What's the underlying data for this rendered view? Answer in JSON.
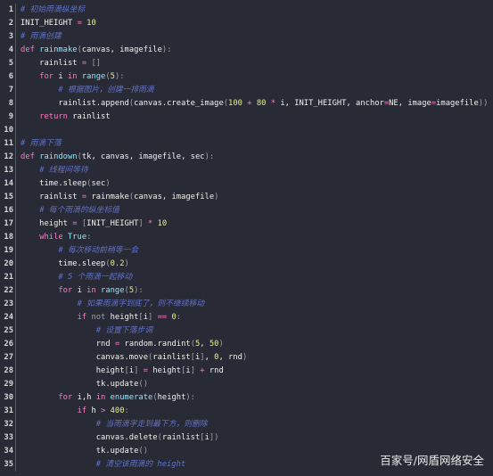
{
  "editor": {
    "lines": [
      {
        "n": "1",
        "tokens": [
          [
            "c",
            "# 初始雨滴纵坐标"
          ]
        ]
      },
      {
        "n": "2",
        "tokens": [
          [
            "t",
            "INIT_HEIGHT "
          ],
          [
            "o",
            "="
          ],
          [
            "t",
            " "
          ],
          [
            "n",
            "10"
          ]
        ]
      },
      {
        "n": "3",
        "tokens": [
          [
            "c",
            "# 雨滴创建"
          ]
        ]
      },
      {
        "n": "4",
        "tokens": [
          [
            "k",
            "def "
          ],
          [
            "f",
            "rainmake"
          ],
          [
            "p",
            "("
          ],
          [
            "t",
            "canvas, imagefile"
          ],
          [
            "p",
            "):"
          ]
        ]
      },
      {
        "n": "5",
        "tokens": [
          [
            "t",
            "    rainlist "
          ],
          [
            "o",
            "="
          ],
          [
            "p",
            " []"
          ]
        ]
      },
      {
        "n": "6",
        "tokens": [
          [
            "t",
            "    "
          ],
          [
            "k",
            "for "
          ],
          [
            "t",
            "i "
          ],
          [
            "k",
            "in "
          ],
          [
            "f",
            "range"
          ],
          [
            "p",
            "("
          ],
          [
            "n",
            "5"
          ],
          [
            "p",
            "):"
          ]
        ]
      },
      {
        "n": "7",
        "tokens": [
          [
            "t",
            "        "
          ],
          [
            "c",
            "# 根据图片，创建一排雨滴"
          ]
        ]
      },
      {
        "n": "8",
        "tokens": [
          [
            "t",
            "        rainlist.append"
          ],
          [
            "p",
            "("
          ],
          [
            "t",
            "canvas.create_image"
          ],
          [
            "p",
            "("
          ],
          [
            "n",
            "100"
          ],
          [
            "o",
            " + "
          ],
          [
            "n",
            "80"
          ],
          [
            "o",
            " * "
          ],
          [
            "t",
            "i, INIT_HEIGHT, anchor"
          ],
          [
            "o",
            "="
          ],
          [
            "t",
            "NE, image"
          ],
          [
            "o",
            "="
          ],
          [
            "t",
            "imagefile"
          ],
          [
            "p",
            "))"
          ]
        ]
      },
      {
        "n": "9",
        "tokens": [
          [
            "t",
            "    "
          ],
          [
            "k",
            "return "
          ],
          [
            "t",
            "rainlist"
          ]
        ]
      },
      {
        "n": "10",
        "tokens": []
      },
      {
        "n": "11",
        "tokens": [
          [
            "c",
            "# 雨滴下落"
          ]
        ]
      },
      {
        "n": "12",
        "tokens": [
          [
            "k",
            "def "
          ],
          [
            "f",
            "raindown"
          ],
          [
            "p",
            "("
          ],
          [
            "t",
            "tk, canvas, imagefile, sec"
          ],
          [
            "p",
            "):"
          ]
        ]
      },
      {
        "n": "13",
        "tokens": [
          [
            "t",
            "    "
          ],
          [
            "c",
            "# 线程间等待"
          ]
        ]
      },
      {
        "n": "14",
        "tokens": [
          [
            "t",
            "    time.sleep"
          ],
          [
            "p",
            "("
          ],
          [
            "t",
            "sec"
          ],
          [
            "p",
            ")"
          ]
        ]
      },
      {
        "n": "15",
        "tokens": [
          [
            "t",
            "    rainlist "
          ],
          [
            "o",
            "="
          ],
          [
            "t",
            " rainmake"
          ],
          [
            "p",
            "("
          ],
          [
            "t",
            "canvas, imagefile"
          ],
          [
            "p",
            ")"
          ]
        ]
      },
      {
        "n": "16",
        "tokens": [
          [
            "t",
            "    "
          ],
          [
            "c",
            "# 每个雨滴的纵坐标值"
          ]
        ]
      },
      {
        "n": "17",
        "tokens": [
          [
            "t",
            "    height "
          ],
          [
            "o",
            "="
          ],
          [
            "p",
            " ["
          ],
          [
            "t",
            "INIT_HEIGHT"
          ],
          [
            "p",
            "]"
          ],
          [
            "o",
            " * "
          ],
          [
            "n",
            "10"
          ]
        ]
      },
      {
        "n": "18",
        "tokens": [
          [
            "t",
            "    "
          ],
          [
            "k",
            "while "
          ],
          [
            "f",
            "True"
          ],
          [
            "p",
            ":"
          ]
        ]
      },
      {
        "n": "19",
        "tokens": [
          [
            "t",
            "        "
          ],
          [
            "c",
            "# 每次移动前稍等一会"
          ]
        ]
      },
      {
        "n": "20",
        "tokens": [
          [
            "t",
            "        time.sleep"
          ],
          [
            "p",
            "("
          ],
          [
            "n",
            "0.2"
          ],
          [
            "p",
            ")"
          ]
        ]
      },
      {
        "n": "21",
        "tokens": [
          [
            "t",
            "        "
          ],
          [
            "c",
            "# 5 个雨滴一起移动"
          ]
        ]
      },
      {
        "n": "22",
        "tokens": [
          [
            "t",
            "        "
          ],
          [
            "k",
            "for "
          ],
          [
            "t",
            "i "
          ],
          [
            "k",
            "in "
          ],
          [
            "f",
            "range"
          ],
          [
            "p",
            "("
          ],
          [
            "n",
            "5"
          ],
          [
            "p",
            "):"
          ]
        ]
      },
      {
        "n": "23",
        "tokens": [
          [
            "t",
            "            "
          ],
          [
            "c",
            "# 如果雨滴字到底了，则不继续移动"
          ]
        ]
      },
      {
        "n": "24",
        "tokens": [
          [
            "t",
            "            "
          ],
          [
            "k",
            "if "
          ],
          [
            "p",
            "not "
          ],
          [
            "t",
            "height"
          ],
          [
            "p",
            "["
          ],
          [
            "t",
            "i"
          ],
          [
            "p",
            "]"
          ],
          [
            "o",
            " == "
          ],
          [
            "n",
            "0"
          ],
          [
            "p",
            ":"
          ]
        ]
      },
      {
        "n": "25",
        "tokens": [
          [
            "t",
            "                "
          ],
          [
            "c",
            "# 设置下落步调"
          ]
        ]
      },
      {
        "n": "26",
        "tokens": [
          [
            "t",
            "                rnd "
          ],
          [
            "o",
            "="
          ],
          [
            "t",
            " random.randint"
          ],
          [
            "p",
            "("
          ],
          [
            "n",
            "5"
          ],
          [
            "t",
            ", "
          ],
          [
            "n",
            "50"
          ],
          [
            "p",
            ")"
          ]
        ]
      },
      {
        "n": "27",
        "tokens": [
          [
            "t",
            "                canvas.move"
          ],
          [
            "p",
            "("
          ],
          [
            "t",
            "rainlist"
          ],
          [
            "p",
            "["
          ],
          [
            "t",
            "i"
          ],
          [
            "p",
            "]"
          ],
          [
            "t",
            ", "
          ],
          [
            "n",
            "0"
          ],
          [
            "t",
            ", rnd"
          ],
          [
            "p",
            ")"
          ]
        ]
      },
      {
        "n": "28",
        "tokens": [
          [
            "t",
            "                height"
          ],
          [
            "p",
            "["
          ],
          [
            "t",
            "i"
          ],
          [
            "p",
            "]"
          ],
          [
            "o",
            " = "
          ],
          [
            "t",
            "height"
          ],
          [
            "p",
            "["
          ],
          [
            "t",
            "i"
          ],
          [
            "p",
            "]"
          ],
          [
            "o",
            " + "
          ],
          [
            "t",
            "rnd"
          ]
        ]
      },
      {
        "n": "29",
        "tokens": [
          [
            "t",
            "                tk.update"
          ],
          [
            "p",
            "()"
          ]
        ]
      },
      {
        "n": "30",
        "tokens": [
          [
            "t",
            "        "
          ],
          [
            "k",
            "for "
          ],
          [
            "t",
            "i,h "
          ],
          [
            "k",
            "in "
          ],
          [
            "f",
            "enumerate"
          ],
          [
            "p",
            "("
          ],
          [
            "t",
            "height"
          ],
          [
            "p",
            "):"
          ]
        ]
      },
      {
        "n": "31",
        "tokens": [
          [
            "t",
            "            "
          ],
          [
            "k",
            "if "
          ],
          [
            "t",
            "h "
          ],
          [
            "o",
            "> "
          ],
          [
            "n",
            "400"
          ],
          [
            "p",
            ":"
          ]
        ]
      },
      {
        "n": "32",
        "tokens": [
          [
            "t",
            "                "
          ],
          [
            "c",
            "# 当雨滴字走到最下方，则删除"
          ]
        ]
      },
      {
        "n": "33",
        "tokens": [
          [
            "t",
            "                canvas.delete"
          ],
          [
            "p",
            "("
          ],
          [
            "t",
            "rainlist"
          ],
          [
            "p",
            "["
          ],
          [
            "t",
            "i"
          ],
          [
            "p",
            "])"
          ]
        ]
      },
      {
        "n": "34",
        "tokens": [
          [
            "t",
            "                tk.update"
          ],
          [
            "p",
            "()"
          ]
        ]
      },
      {
        "n": "35",
        "tokens": [
          [
            "t",
            "                "
          ],
          [
            "c",
            "# 清空该雨滴的 height"
          ]
        ]
      }
    ]
  },
  "watermark": "百家号/网盾网络安全",
  "colors": {
    "background": "#282a36",
    "keyword": "#ff79c6",
    "function": "#8be9fd",
    "number": "#e6ef8a",
    "comment": "#6272c4",
    "text": "#f1f1ec"
  }
}
